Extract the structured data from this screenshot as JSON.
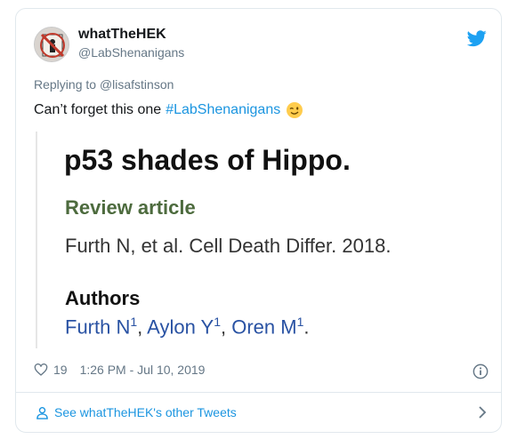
{
  "user": {
    "display_name": "whatTheHEK",
    "handle": "@LabShenanigans"
  },
  "tweet": {
    "replying_prefix": "Replying to",
    "replying_to": "@lisafstinson",
    "text": "Can’t forget this one",
    "hashtag": "#LabShenanigans",
    "emoji": "winking-face"
  },
  "quote_image": {
    "title": "p53 shades of Hippo.",
    "article_type": "Review article",
    "citation": "Furth N, et al. Cell Death Differ. 2018.",
    "authors_heading": "Authors",
    "authors": [
      {
        "name": "Furth N",
        "affil": "1",
        "sep": ", "
      },
      {
        "name": "Aylon Y",
        "affil": "1",
        "sep": ", "
      },
      {
        "name": "Oren M",
        "affil": "1",
        "sep": "."
      }
    ]
  },
  "meta": {
    "likes": "19",
    "timestamp": "1:26 PM - Jul 10, 2019"
  },
  "footer": {
    "link_text": "See whatTheHEK's other Tweets"
  },
  "colors": {
    "accent": "#1b95e0",
    "muted": "#657786",
    "article_type": "#4d6b3e",
    "author_link": "#2952a3"
  }
}
